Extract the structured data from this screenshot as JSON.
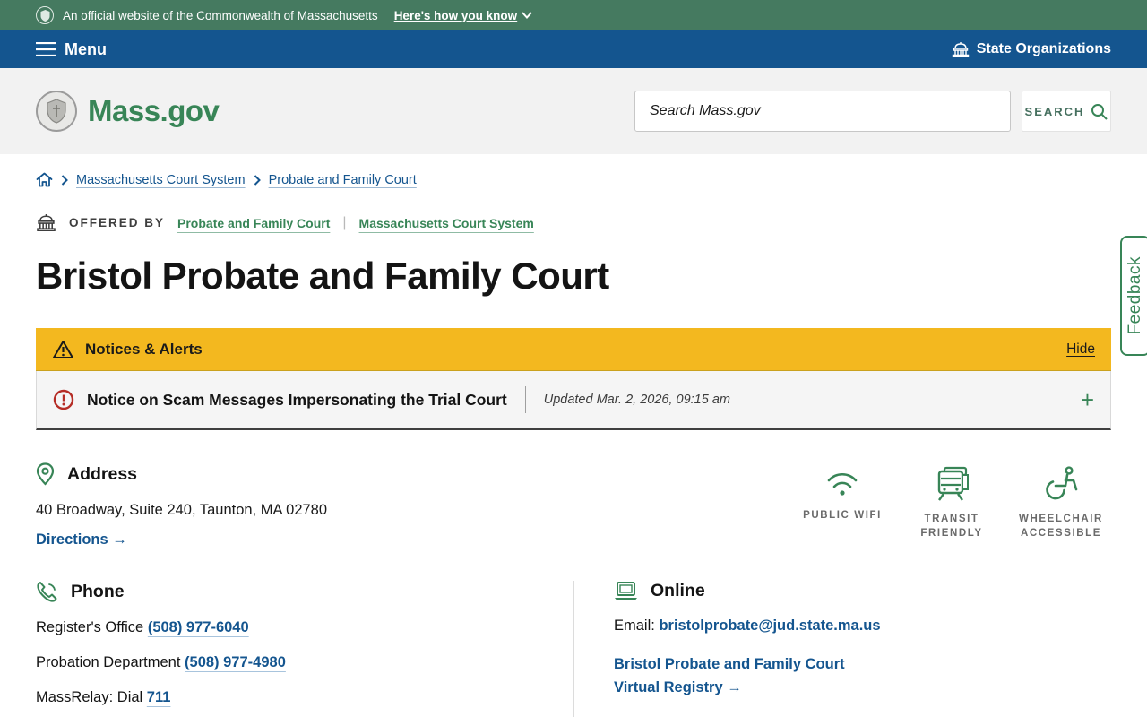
{
  "banner": {
    "official_text": "An official website of the Commonwealth of Massachusetts",
    "how_you_know_label": "Here's how you know"
  },
  "menubar": {
    "menu_label": "Menu",
    "state_organizations_label": "State Organizations"
  },
  "header": {
    "logo_text": "Mass.gov",
    "search_placeholder": "Search Mass.gov",
    "search_button_label": "SEARCH"
  },
  "breadcrumb": {
    "items": [
      {
        "label": "Massachusetts Court System"
      },
      {
        "label": "Probate and Family Court"
      }
    ]
  },
  "offered_by": {
    "label": "OFFERED BY",
    "links": [
      {
        "label": "Probate and Family Court"
      },
      {
        "label": "Massachusetts Court System"
      }
    ]
  },
  "page": {
    "title": "Bristol Probate and Family Court"
  },
  "alerts": {
    "header_title": "Notices & Alerts",
    "hide_label": "Hide",
    "notice": {
      "title": "Notice on Scam Messages Impersonating the Trial Court",
      "updated": "Updated Mar. 2, 2026, 09:15 am",
      "expand_label": "+"
    }
  },
  "address": {
    "heading": "Address",
    "line": "40 Broadway, Suite 240, Taunton, MA 02780",
    "directions_label": "Directions →"
  },
  "amenities": [
    {
      "label": "PUBLIC WIFI",
      "icon": "wifi-icon"
    },
    {
      "label": "TRANSIT FRIENDLY",
      "icon": "transit-icon"
    },
    {
      "label": "WHEELCHAIR ACCESSIBLE",
      "icon": "wheelchair-icon"
    }
  ],
  "phone": {
    "heading": "Phone",
    "rows": [
      {
        "label": "Register's Office",
        "link": "(508) 977-6040"
      },
      {
        "label": "Probation Department",
        "link": "(508) 977-4980"
      },
      {
        "label": "MassRelay: Dial",
        "link": "711"
      }
    ]
  },
  "online": {
    "heading": "Online",
    "email_label": "Email:",
    "email_link": "bristolprobate@jud.state.ma.us",
    "registry_link_line1": "Bristol Probate and Family Court",
    "registry_link_line2": "Virtual Registry →"
  },
  "feedback": {
    "label": "Feedback"
  },
  "colors": {
    "banner_green": "#457a60",
    "menubar_blue": "#14558f",
    "header_gray": "#f2f2f2",
    "brand_green": "#388557",
    "link_blue": "#14558f",
    "alert_yellow": "#f3b81f",
    "notice_red": "#b52c25"
  }
}
